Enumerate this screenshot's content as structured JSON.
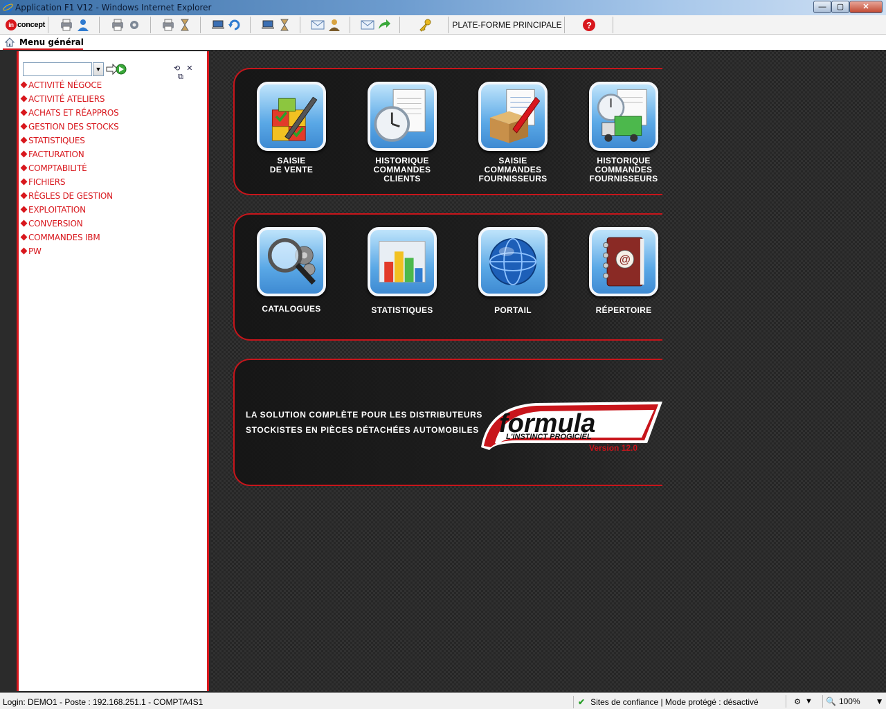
{
  "window": {
    "title": "Application F1 V12 - Windows Internet Explorer",
    "min_label": "—",
    "max_label": "▢",
    "close_label": "✕"
  },
  "toolbar": {
    "logo_text": "concept",
    "logo_badge": "in",
    "platform_label": "PLATE-FORME PRINCIPALE",
    "icons": [
      "printer-user-icon",
      "printer-gear-icon",
      "printer-hourglass-icon",
      "laptop-refresh-icon",
      "laptop-hourglass-icon",
      "mail-user-icon",
      "mail-forward-icon",
      "key-icon",
      "help-icon"
    ]
  },
  "menu_tab": {
    "label": "Menu général"
  },
  "sidebar": {
    "search_value": "",
    "items": [
      "ACTIVITÉ NÉGOCE",
      "ACTIVITÉ ATELIERS",
      "ACHATS ET RÉAPPROS",
      "GESTION DES STOCKS",
      "STATISTIQUES",
      "FACTURATION",
      "COMPTABILITÉ",
      "FICHIERS",
      "RÈGLES DE GESTION",
      "EXPLOITATION",
      "CONVERSION",
      "COMMANDES IBM",
      "PW"
    ]
  },
  "tiles_row1": [
    {
      "lines": [
        "SAISIE",
        "DE VENTE"
      ],
      "icon": "sales-entry-icon"
    },
    {
      "lines": [
        "HISTORIQUE",
        "COMMANDES",
        "CLIENTS"
      ],
      "icon": "customer-history-icon"
    },
    {
      "lines": [
        "SAISIE",
        "COMMANDES",
        "FOURNISSEURS"
      ],
      "icon": "supplier-order-icon"
    },
    {
      "lines": [
        "HISTORIQUE",
        "COMMANDES",
        "FOURNISSEURS"
      ],
      "icon": "supplier-history-icon"
    }
  ],
  "tiles_row2": [
    {
      "lines": [
        "CATALOGUES"
      ],
      "icon": "catalog-search-icon"
    },
    {
      "lines": [
        "STATISTIQUES"
      ],
      "icon": "bar-chart-icon"
    },
    {
      "lines": [
        "PORTAIL"
      ],
      "icon": "globe-icon"
    },
    {
      "lines": [
        "RÉPERTOIRE"
      ],
      "icon": "address-book-icon"
    }
  ],
  "branding": {
    "slogan_line1": "LA SOLUTION COMPLÈTE POUR LES DISTRIBUTEURS",
    "slogan_line2": "STOCKISTES EN PIÈCES DÉTACHÉES AUTOMOBILES",
    "logo_word": "formula",
    "logo_tagline": "L'INSTINCT PROGICIEL",
    "version": "Version 12.0"
  },
  "status": {
    "login": "Login: DEMO1 - Poste : 192.168.251.1 - COMPTA4S1",
    "zone": "Sites de confiance | Mode protégé : désactivé",
    "zoom": "100%"
  },
  "colors": {
    "accent": "#d8171d",
    "tile": "#5aa8e6"
  }
}
